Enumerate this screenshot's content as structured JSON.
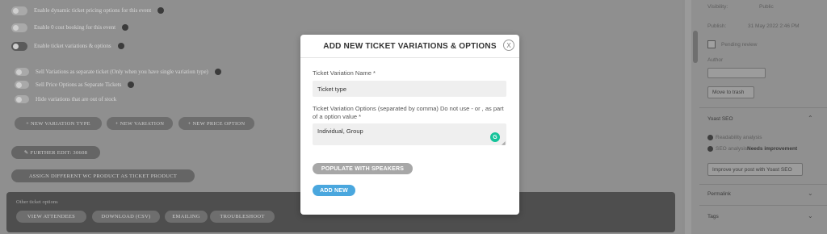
{
  "modal": {
    "title": "ADD NEW TICKET VARIATIONS & OPTIONS",
    "close_label": "X",
    "name_label": "Ticket Variation Name *",
    "name_value": "Ticket type",
    "options_label": "Ticket Variation Options (separated by comma) Do not use - or , as part of a option value *",
    "options_value": "Individual, Group",
    "populate_button": "POPULATE WITH SPEAKERS",
    "add_button": "ADD NEW"
  },
  "background": {
    "options": [
      "Enable dynamic ticket pricing options for this event",
      "Enable 0 cost booking for this event",
      "Enable ticket variations & options"
    ],
    "sub_options": [
      "Sell Variations as separate ticket (Only when you have single variation type)",
      "Sell Price Options as Separate Tickets",
      "Hide variations that are out of stock"
    ],
    "variation_buttons": [
      "+ NEW VARIATION TYPE",
      "+ NEW VARIATION",
      "+ NEW PRICE OPTION"
    ],
    "further_button": "✎ FURTHER EDIT: 30608",
    "assign_button": "ASSIGN DIFFERENT WC PRODUCT AS TICKET PRODUCT",
    "other_title": "Other ticket options",
    "other_buttons": [
      "VIEW ATTENDEES",
      "DOWNLOAD (CSV)",
      "EMAILING",
      "TROUBLESHOOT"
    ]
  },
  "sidebar": {
    "visibility_label": "Visibility:",
    "visibility_value": "Public",
    "publish_label": "Publish:",
    "publish_value": "31 May 2022 2:46 PM",
    "pending_review": "Pending review",
    "author_label": "Author",
    "trash_button": "Move to trash",
    "yoast_title": "Yoast SEO",
    "readability": "Readability analysis",
    "seo_analysis": "SEO analysis:",
    "seo_status": "Needs improvement",
    "improve_button": "Improve your post with Yoast SEO",
    "permalink": "Permalink",
    "tags": "Tags"
  }
}
